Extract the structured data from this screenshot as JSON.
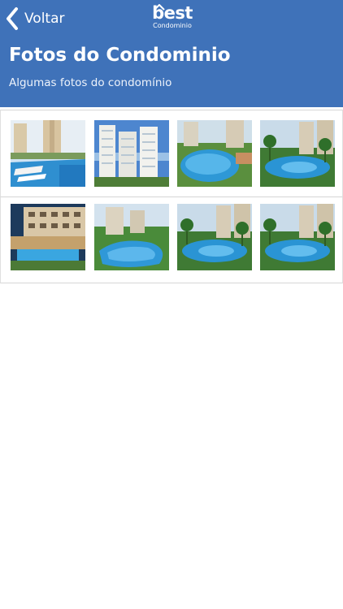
{
  "header": {
    "back_label": "Voltar",
    "logo_main": "best",
    "logo_sub": "Condominio",
    "title": "Fotos do Condominio",
    "subtitle": "Algumas fotos do condomínio"
  },
  "gallery": {
    "rows": [
      [
        {
          "scene": "tower-pool-loungers"
        },
        {
          "scene": "three-towers"
        },
        {
          "scene": "pool-aerial-towers"
        },
        {
          "scene": "pool-palms-towers"
        }
      ],
      [
        {
          "scene": "lowrise-pool"
        },
        {
          "scene": "pool-towers-curved"
        },
        {
          "scene": "pool-palms-towers"
        },
        {
          "scene": "pool-palms-towers"
        }
      ]
    ]
  },
  "colors": {
    "header_bg": "#3f72b9",
    "header_text": "#ffffff"
  }
}
